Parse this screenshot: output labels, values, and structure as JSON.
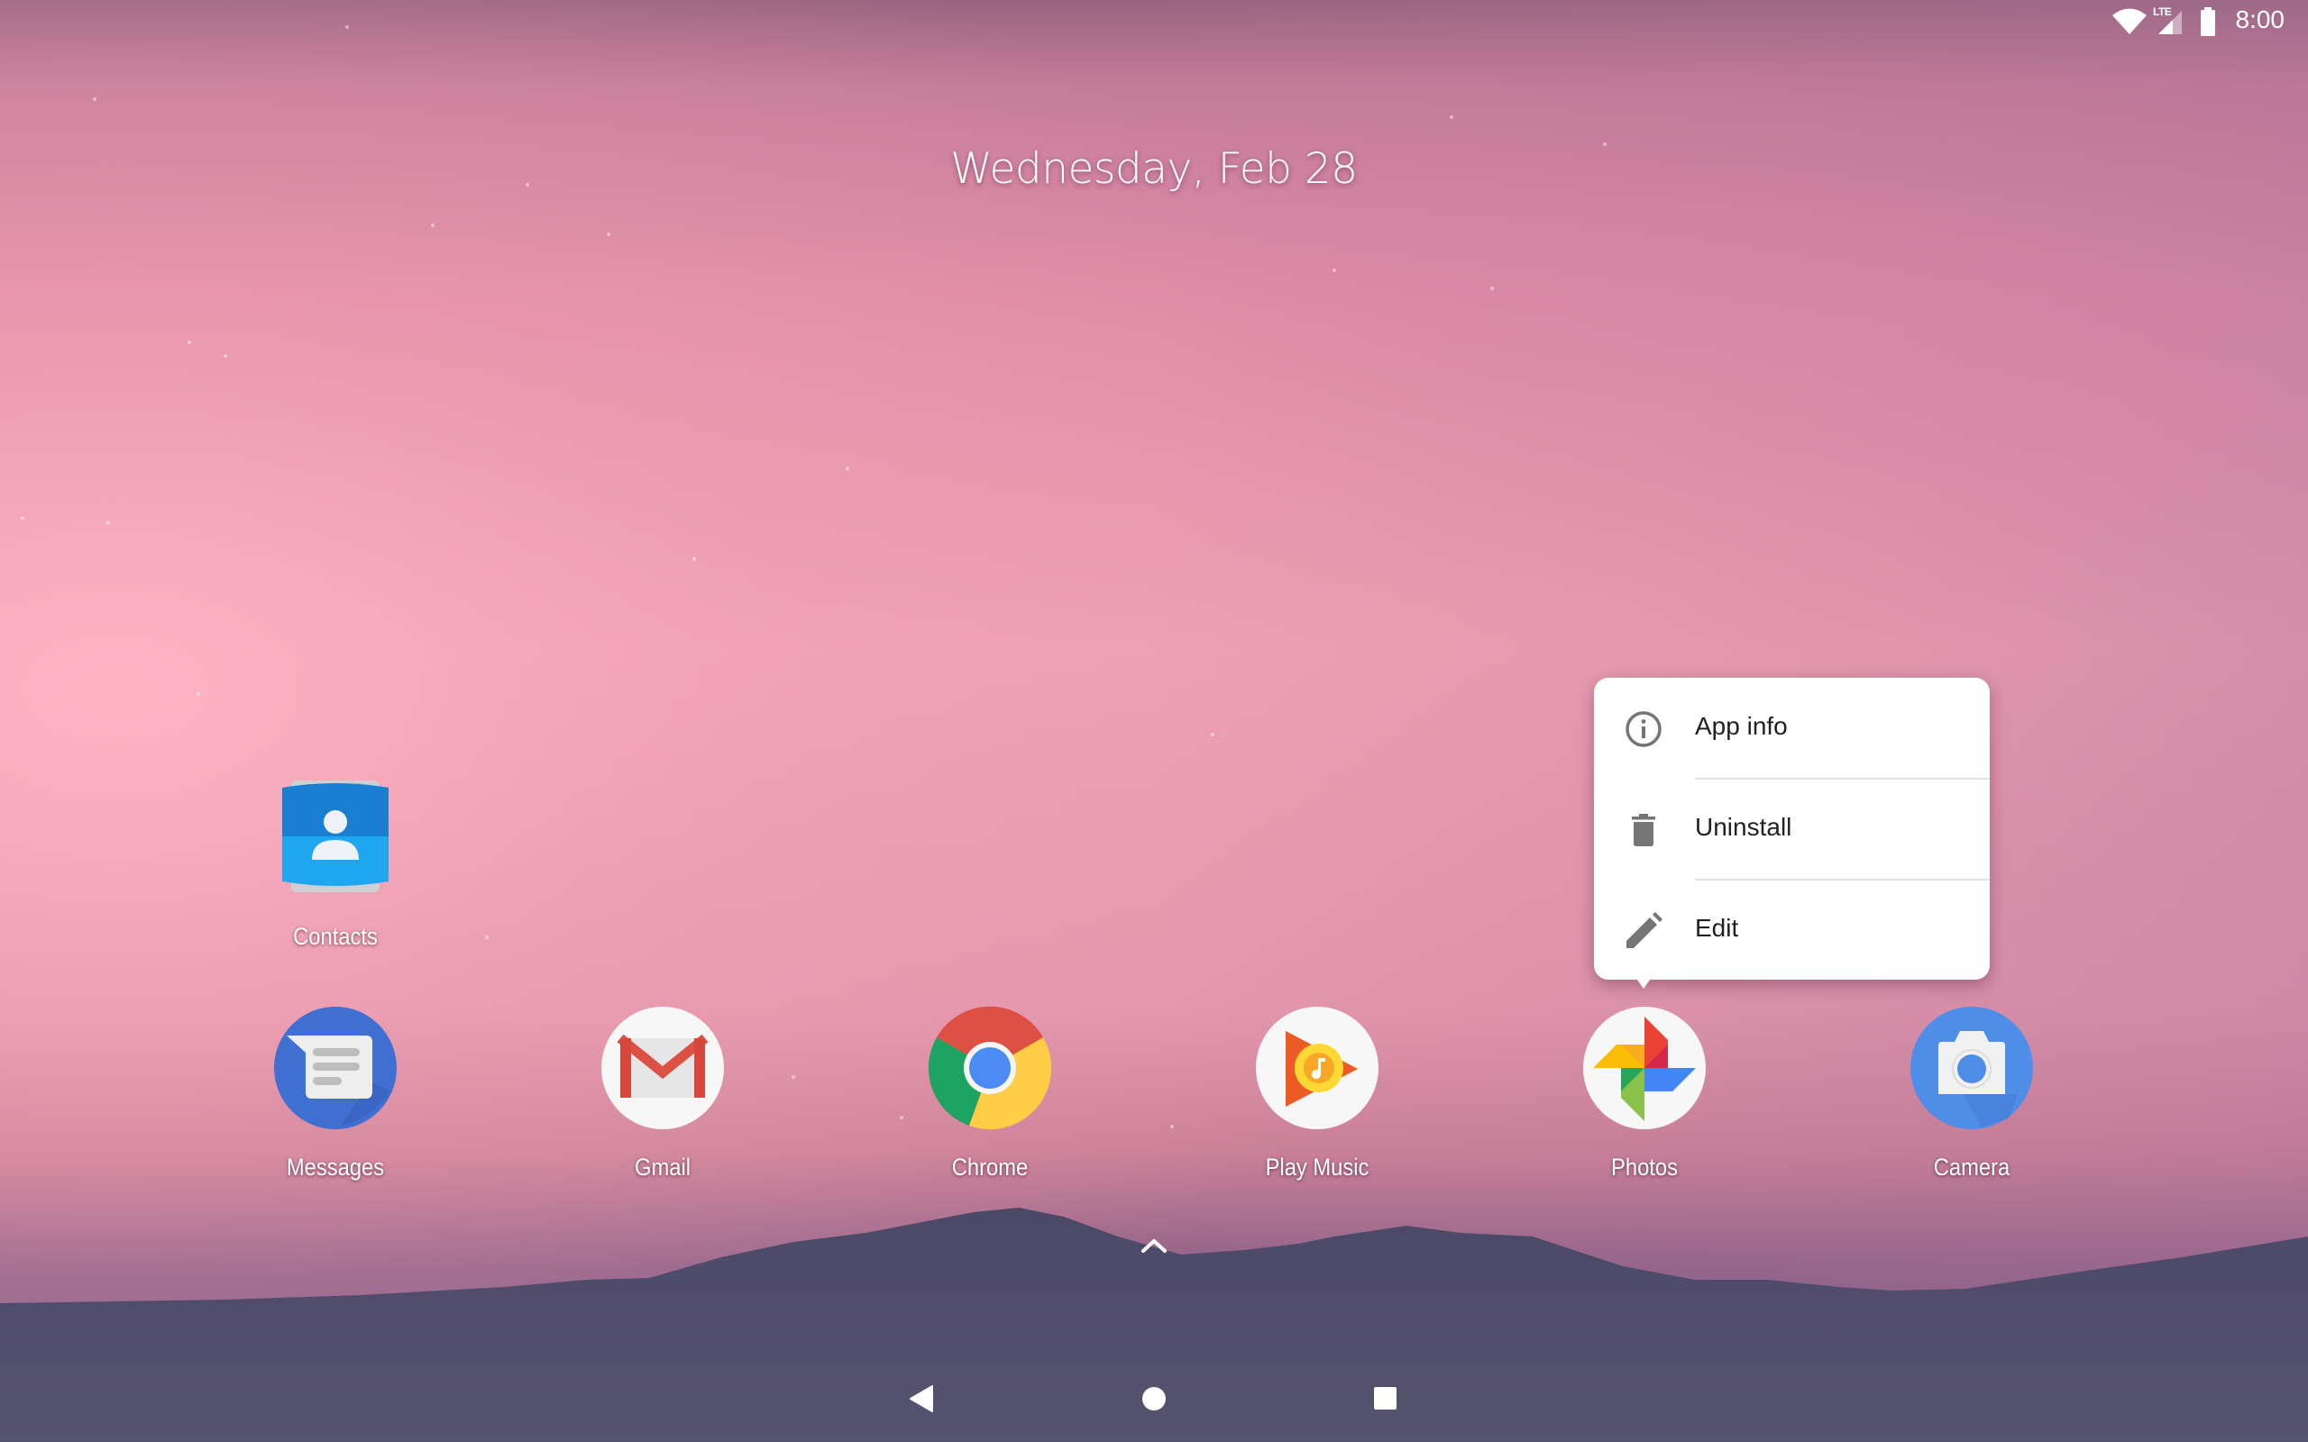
{
  "status_bar": {
    "wifi_icon": "wifi-full-icon",
    "network_label": "LTE",
    "signal_icon": "cell-signal-icon",
    "battery_icon": "battery-full-icon",
    "time": "8:00"
  },
  "home": {
    "date": "Wednesday, Feb 28",
    "workspace_apps": [
      {
        "label": "Contacts",
        "icon": "contacts-icon"
      }
    ],
    "dock_apps": [
      {
        "label": "Messages",
        "icon": "messages-icon"
      },
      {
        "label": "Gmail",
        "icon": "gmail-icon"
      },
      {
        "label": "Chrome",
        "icon": "chrome-icon"
      },
      {
        "label": "Play Music",
        "icon": "play-music-icon"
      },
      {
        "label": "Photos",
        "icon": "photos-icon"
      },
      {
        "label": "Camera",
        "icon": "camera-icon"
      }
    ],
    "app_drawer_icon": "chevron-up-icon"
  },
  "shortcut_menu": {
    "target_app": "Photos",
    "items": [
      {
        "label": "App info",
        "icon": "info-icon"
      },
      {
        "label": "Uninstall",
        "icon": "trash-icon"
      },
      {
        "label": "Edit",
        "icon": "pencil-icon"
      }
    ]
  },
  "navigation_bar": {
    "back_icon": "back-icon",
    "home_icon": "home-icon",
    "recents_icon": "recents-icon"
  },
  "colors": {
    "sky_top": "#a06a84",
    "sky_mid": "#f4a9b8",
    "sky_right": "#cc86a2",
    "dusk": "#8e6490",
    "mountain": "#4e4a6c",
    "menu_text": "#212121",
    "menu_icon": "#757575"
  }
}
